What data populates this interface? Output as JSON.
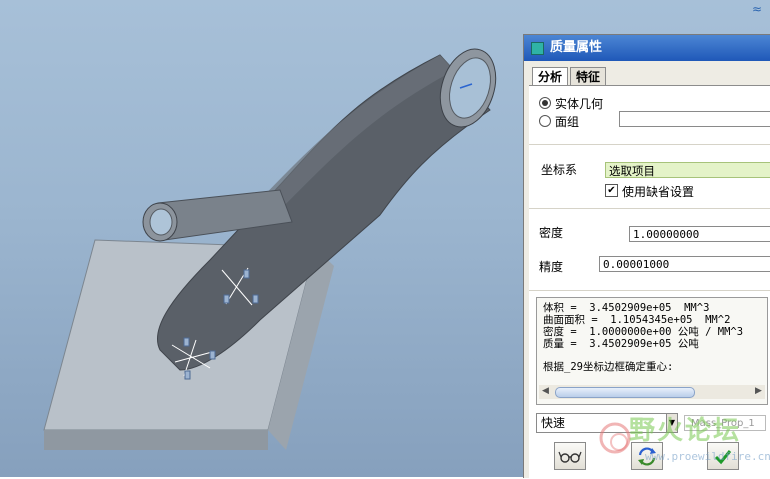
{
  "dialog": {
    "title": "质量属性",
    "tabs": [
      {
        "label": "分析"
      },
      {
        "label": "特征"
      }
    ],
    "geometry": {
      "solid_label": "实体几何",
      "quilt_label": "面组",
      "selected": "solid"
    },
    "coordinate_system": {
      "label": "坐标系",
      "select_label": "选取项目",
      "use_default_label": "使用缺省设置",
      "use_default_checked": true
    },
    "density": {
      "label": "密度",
      "value": "1.00000000"
    },
    "accuracy": {
      "label": "精度",
      "value": "0.00001000"
    },
    "results": {
      "lines": [
        "体积 =  3.4502909e+05  MM^3",
        "曲面面积 =  1.1054345e+05  MM^2",
        "密度 =  1.0000000e+00 公吨 / MM^3",
        "质量 =  3.4502909e+05 公吨"
      ],
      "note": "根据_29坐标边框确定重心:"
    },
    "mode_select": {
      "value": "快速"
    },
    "name_field": {
      "value": "Mass_Prop_1"
    }
  },
  "watermark": {
    "text": "野火论坛",
    "url": "www.proewildfire.cn"
  },
  "colors": {
    "titlebar": "#1f58b8",
    "highlight_field": "#e4f3c8",
    "model": "#585e66",
    "plate": "#b8c0c8"
  }
}
